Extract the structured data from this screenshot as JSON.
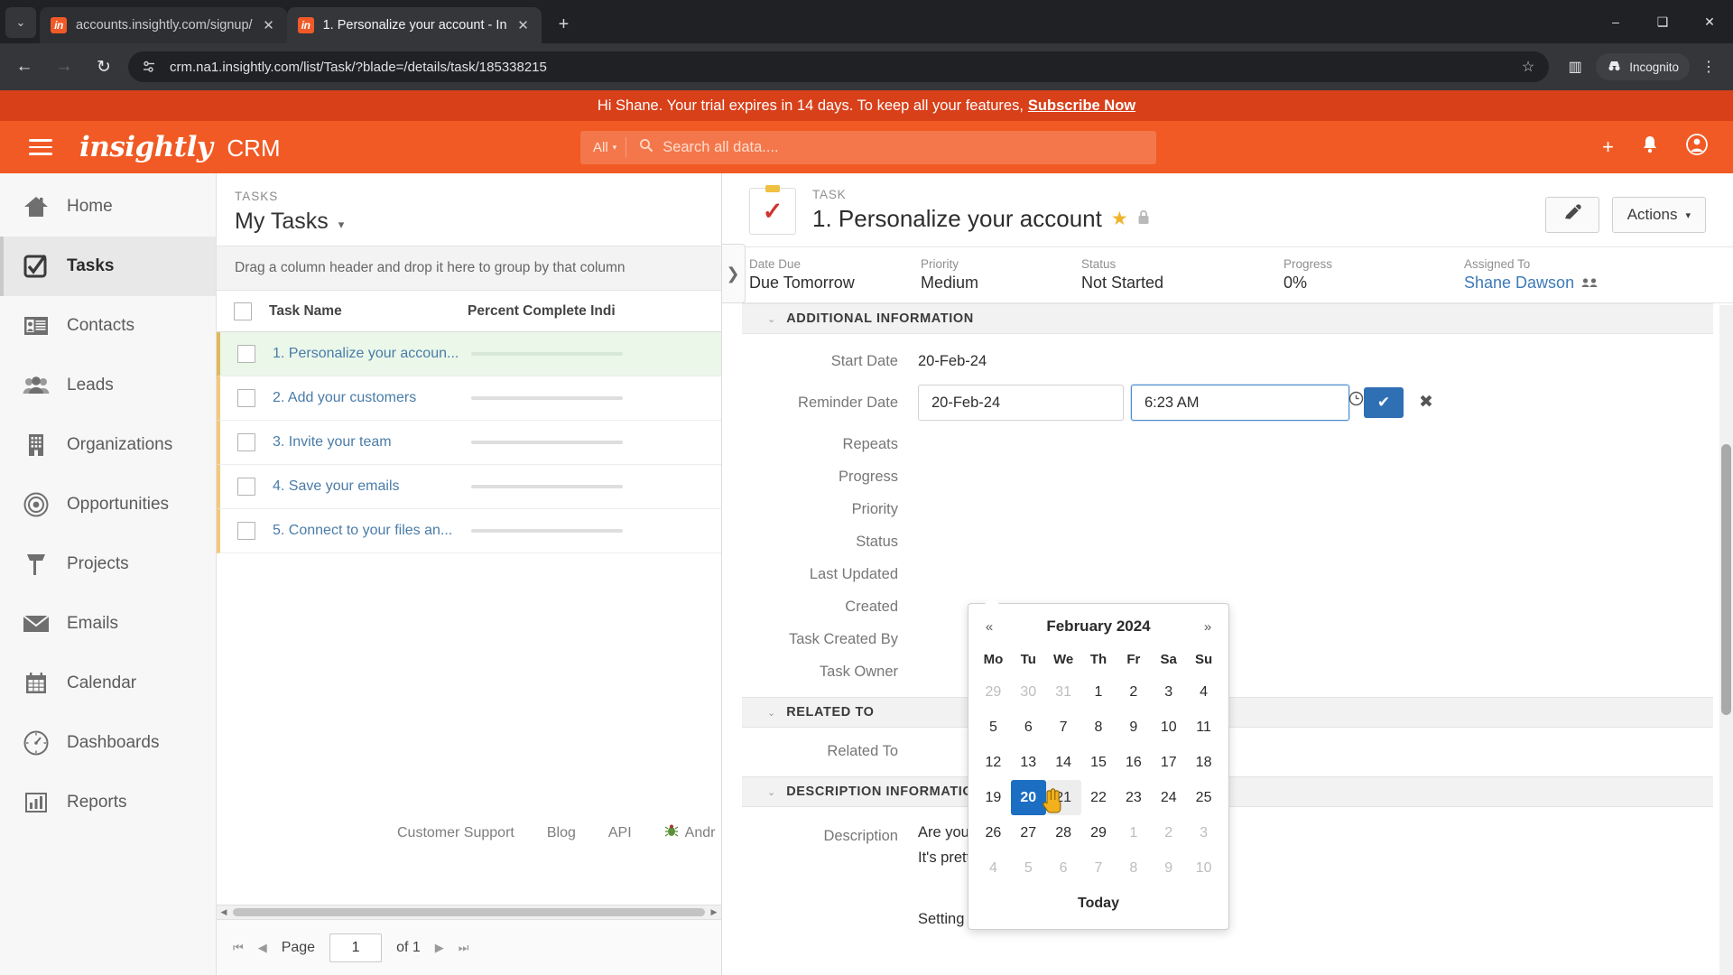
{
  "browser": {
    "tabs": [
      {
        "title": "accounts.insightly.com/signup/",
        "favicon": "in",
        "active": false
      },
      {
        "title": "1. Personalize your account - In",
        "favicon": "in",
        "active": true
      }
    ],
    "newtab_label": "+",
    "window_controls": {
      "minimize": "–",
      "maximize": "❑",
      "close": "✕"
    },
    "nav": {
      "back": "←",
      "forward": "→",
      "reload": "↻"
    },
    "url": "crm.na1.insightly.com/list/Task/?blade=/details/task/185338215",
    "star_icon": "☆",
    "side_panel_icon": "▥",
    "incognito_label": "Incognito",
    "menu_icon": "⋮"
  },
  "banner": {
    "text": "Hi Shane. Your trial expires in 14 days. To keep all your features,",
    "link": "Subscribe Now",
    "bg": "#d8401a"
  },
  "appbar": {
    "logo": "insightly",
    "product": "CRM",
    "search_scope": "All",
    "search_placeholder": "Search all data....",
    "search_value": "",
    "add_icon": "+",
    "bell_icon": "🔔",
    "avatar_icon": "●",
    "accent": "#f15a24"
  },
  "sidebar": {
    "items": [
      {
        "label": "Home",
        "icon": "home-icon",
        "active": false
      },
      {
        "label": "Tasks",
        "icon": "task-check-icon",
        "active": true
      },
      {
        "label": "Contacts",
        "icon": "contact-card-icon",
        "active": false
      },
      {
        "label": "Leads",
        "icon": "people-icon",
        "active": false
      },
      {
        "label": "Organizations",
        "icon": "building-icon",
        "active": false
      },
      {
        "label": "Opportunities",
        "icon": "target-icon",
        "active": false
      },
      {
        "label": "Projects",
        "icon": "hammer-icon",
        "active": false
      },
      {
        "label": "Emails",
        "icon": "envelope-icon",
        "active": false
      },
      {
        "label": "Calendar",
        "icon": "calendar-icon",
        "active": false
      },
      {
        "label": "Dashboards",
        "icon": "gauge-icon",
        "active": false
      },
      {
        "label": "Reports",
        "icon": "bar-chart-icon",
        "active": false
      }
    ]
  },
  "list_pane": {
    "eyebrow": "TASKS",
    "title": "My Tasks",
    "title_caret": "▾",
    "group_hint": "Drag a column header and drop it here to group by that column",
    "columns": [
      "Task Name",
      "Percent Complete Indi"
    ],
    "rows": [
      {
        "name": "1. Personalize your accoun...",
        "selected": true
      },
      {
        "name": "2. Add your customers",
        "selected": false
      },
      {
        "name": "3. Invite your team",
        "selected": false
      },
      {
        "name": "4. Save your emails",
        "selected": false
      },
      {
        "name": "5. Connect to your files an...",
        "selected": false
      }
    ],
    "pager": {
      "first": "⏮",
      "prev": "◀",
      "page_label": "Page",
      "page_value": "1",
      "of_label": "of 1",
      "next": "▶",
      "last": "⏭"
    }
  },
  "blade": {
    "expander_icon": "❯",
    "eyebrow": "TASK",
    "title": "1. Personalize your account",
    "star_icon": "★",
    "lock_icon": "🔒",
    "edit_icon": "✎",
    "actions_label": "Actions",
    "actions_caret": "▾",
    "meta": [
      {
        "key": "Date Due",
        "value": "Due Tomorrow",
        "link": false
      },
      {
        "key": "Priority",
        "value": "Medium",
        "link": false
      },
      {
        "key": "Status",
        "value": "Not Started",
        "link": false
      },
      {
        "key": "Progress",
        "value": "0%",
        "link": false
      },
      {
        "key": "Assigned To",
        "value": "Shane Dawson",
        "link": true,
        "people_icon": "👥"
      }
    ],
    "sections": {
      "additional": {
        "heading": "ADDITIONAL INFORMATION",
        "chev": "⌄",
        "fields": [
          {
            "key": "Start Date",
            "value": "20-Feb-24"
          },
          {
            "key": "Reminder Date",
            "value": ""
          },
          {
            "key": "Repeats",
            "value": ""
          },
          {
            "key": "Progress",
            "value": ""
          },
          {
            "key": "Priority",
            "value": ""
          },
          {
            "key": "Status",
            "value": ""
          },
          {
            "key": "Last Updated",
            "value": ""
          },
          {
            "key": "Created",
            "value": ""
          },
          {
            "key": "Task Created By",
            "value": ""
          },
          {
            "key": "Task Owner",
            "value": ""
          }
        ],
        "reminder_editor": {
          "date_value": "20-Feb-24",
          "date_icon": "calendar-icon",
          "time_value": "6:23 AM",
          "time_icon": "clock-icon",
          "confirm_icon": "✔",
          "cancel_icon": "✖",
          "confirm_color": "#2f6fb4"
        }
      },
      "related": {
        "heading": "RELATED TO",
        "chev": "⌄",
        "fields": [
          {
            "key": "Related To",
            "value": ""
          }
        ]
      },
      "description": {
        "heading": "DESCRIPTION INFORMATIO..",
        "chev": "⌄",
        "key": "Description",
        "lines": [
          "Are you ready to jump into your first task?",
          "It's pretty easy. We promise.",
          "",
          "Setting up your account ensures that"
        ]
      }
    }
  },
  "datepicker": {
    "prev_icon": "«",
    "next_icon": "»",
    "month_label": "February 2024",
    "dow": [
      "Mo",
      "Tu",
      "We",
      "Th",
      "Fr",
      "Sa",
      "Su"
    ],
    "weeks": [
      [
        {
          "d": "29",
          "m": true
        },
        {
          "d": "30",
          "m": true
        },
        {
          "d": "31",
          "m": true
        },
        {
          "d": "1"
        },
        {
          "d": "2"
        },
        {
          "d": "3"
        },
        {
          "d": "4"
        }
      ],
      [
        {
          "d": "5"
        },
        {
          "d": "6"
        },
        {
          "d": "7"
        },
        {
          "d": "8"
        },
        {
          "d": "9"
        },
        {
          "d": "10"
        },
        {
          "d": "11"
        }
      ],
      [
        {
          "d": "12"
        },
        {
          "d": "13"
        },
        {
          "d": "14"
        },
        {
          "d": "15"
        },
        {
          "d": "16"
        },
        {
          "d": "17"
        },
        {
          "d": "18"
        }
      ],
      [
        {
          "d": "19"
        },
        {
          "d": "20",
          "sel": true
        },
        {
          "d": "21",
          "hover": true
        },
        {
          "d": "22"
        },
        {
          "d": "23"
        },
        {
          "d": "24"
        },
        {
          "d": "25"
        }
      ],
      [
        {
          "d": "26"
        },
        {
          "d": "27"
        },
        {
          "d": "28"
        },
        {
          "d": "29"
        },
        {
          "d": "1",
          "m": true
        },
        {
          "d": "2",
          "m": true
        },
        {
          "d": "3",
          "m": true
        }
      ],
      [
        {
          "d": "4",
          "m": true
        },
        {
          "d": "5",
          "m": true
        },
        {
          "d": "6",
          "m": true
        },
        {
          "d": "7",
          "m": true
        },
        {
          "d": "8",
          "m": true
        },
        {
          "d": "9",
          "m": true
        },
        {
          "d": "10",
          "m": true
        }
      ]
    ],
    "today_label": "Today",
    "selected_date": "20",
    "selected_bg": "#1b6ec2"
  },
  "footer": {
    "links": [
      "Customer Support",
      "Blog",
      "API"
    ],
    "bug_label": "Andr",
    "bug_icon": "🐞"
  }
}
